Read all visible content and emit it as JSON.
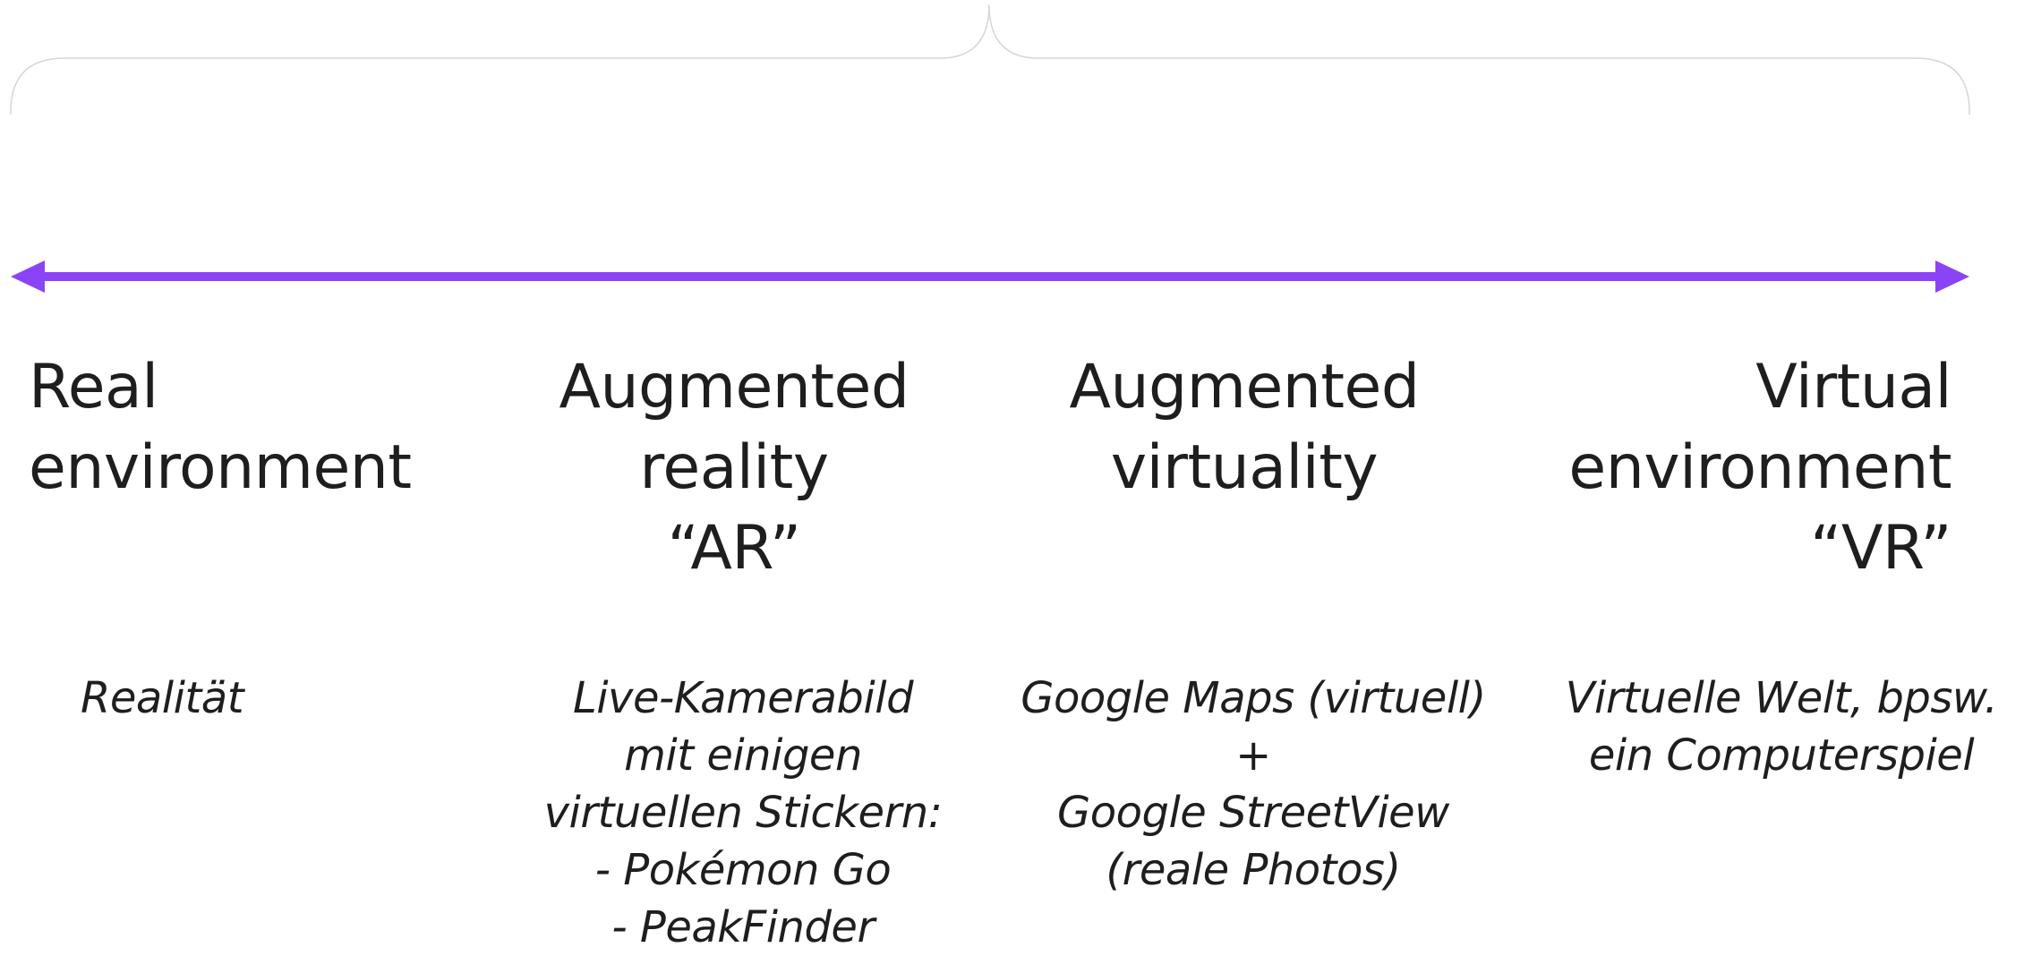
{
  "colors": {
    "arrow": "#8b44f5",
    "brace": "#d6d6d6",
    "text": "#1e1e1e"
  },
  "continuum": {
    "real_environment": {
      "title_lines": [
        "Real",
        "environment"
      ],
      "example_lines": [
        "Realität"
      ]
    },
    "augmented_reality": {
      "title_lines": [
        "Augmented",
        "reality",
        "“AR”"
      ],
      "example_lines": [
        "Live-Kamerabild",
        "mit einigen",
        "virtuellen Stickern:",
        "- Pokémon Go",
        "- PeakFinder"
      ]
    },
    "augmented_virtuality": {
      "title_lines": [
        "Augmented",
        "virtuality"
      ],
      "example_lines": [
        "Google Maps (virtuell)",
        "+",
        "Google StreetView",
        "(reale Photos)"
      ]
    },
    "virtual_environment": {
      "title_lines": [
        "Virtual",
        "environment",
        "“VR”"
      ],
      "example_lines": [
        "Virtuelle Welt, bpsw.",
        "ein Computerspiel"
      ]
    }
  }
}
